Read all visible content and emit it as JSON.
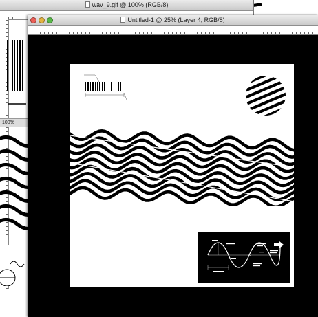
{
  "windows": {
    "back": {
      "title": "wav_9.gif @ 100% (RGB/8)",
      "zoom": "100%"
    },
    "front": {
      "title": "Untitled-1 @ 25% (Layer 4, RGB/8)"
    }
  },
  "colors": {
    "pasteboard": "#000000",
    "canvas": "#ffffff",
    "titlebar": "#d6d6d6"
  },
  "icons": {
    "close": "close-icon",
    "minimize": "minimize-icon",
    "zoom": "zoom-icon",
    "document": "document-icon"
  }
}
